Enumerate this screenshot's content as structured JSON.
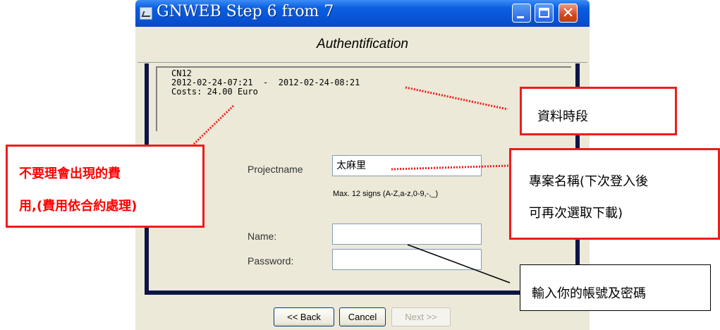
{
  "window": {
    "title": "GNWEB Step 6 from 7",
    "header": "Authentification",
    "title_buttons": {
      "minimize": "",
      "maximize": "",
      "close": "✕"
    }
  },
  "info": {
    "dataset": "CN12",
    "period": "2012-02-24-07:21  -  2012-02-24-08:21",
    "costs": "Costs: 24.00 Euro"
  },
  "form": {
    "project_label": "Projectname",
    "project_value": "太麻里",
    "project_hint": "Max. 12 signs (A-Z,a-z,0-9,-,_)",
    "name_label": "Name:",
    "name_value": "",
    "password_label": "Password:",
    "password_value": ""
  },
  "footer": {
    "back": "<< Back",
    "cancel": "Cancel",
    "next": "Next >>"
  },
  "annotations": {
    "cost_note_line1": "不要理會出現的費",
    "cost_note_line2": "用,(費用依合約處理)",
    "period_note": "資料時段",
    "project_note_line1": "專案名稱(下次登入後",
    "project_note_line2": "可再次選取下載)",
    "account_note": "輸入你的帳號及密碼"
  },
  "colors": {
    "titlebar": "#0753d4",
    "annotation_red": "#ee1c1c",
    "content_border": "#0d1545"
  }
}
